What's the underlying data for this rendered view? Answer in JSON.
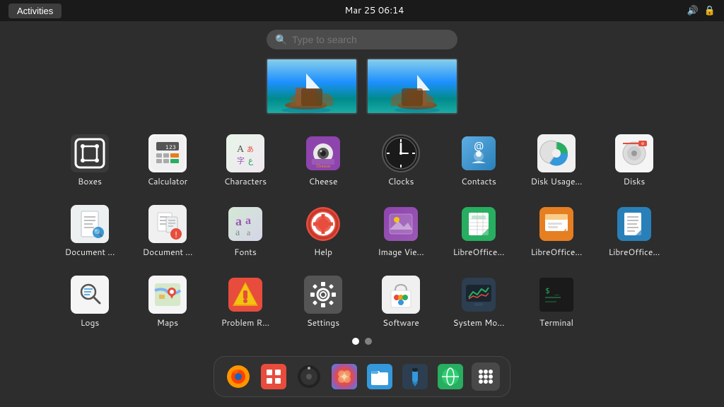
{
  "topbar": {
    "activities_label": "Activities",
    "datetime": "Mar 25  06:14"
  },
  "search": {
    "placeholder": "Type to search"
  },
  "apps": [
    {
      "id": "boxes",
      "label": "Boxes",
      "icon_type": "boxes"
    },
    {
      "id": "calculator",
      "label": "Calculator",
      "icon_type": "calculator"
    },
    {
      "id": "characters",
      "label": "Characters",
      "icon_type": "characters"
    },
    {
      "id": "cheese",
      "label": "Cheese",
      "icon_type": "cheese"
    },
    {
      "id": "clocks",
      "label": "Clocks",
      "icon_type": "clocks"
    },
    {
      "id": "contacts",
      "label": "Contacts",
      "icon_type": "contacts"
    },
    {
      "id": "diskusage",
      "label": "Disk Usage...",
      "icon_type": "diskusage"
    },
    {
      "id": "disks",
      "label": "Disks",
      "icon_type": "disks"
    },
    {
      "id": "docviewer",
      "label": "Document ...",
      "icon_type": "docviewer"
    },
    {
      "id": "docscanner",
      "label": "Document ...",
      "icon_type": "docscanner"
    },
    {
      "id": "fonts",
      "label": "Fonts",
      "icon_type": "fonts"
    },
    {
      "id": "help",
      "label": "Help",
      "icon_type": "help"
    },
    {
      "id": "imageviewer",
      "label": "Image Vie...",
      "icon_type": "imageviewer"
    },
    {
      "id": "libreoffice-calc",
      "label": "LibreOffice...",
      "icon_type": "libreoffice-calc"
    },
    {
      "id": "libreoffice-impress",
      "label": "LibreOffice...",
      "icon_type": "libreoffice-impress"
    },
    {
      "id": "libreoffice-writer",
      "label": "LibreOffice...",
      "icon_type": "libreoffice-writer"
    },
    {
      "id": "logs",
      "label": "Logs",
      "icon_type": "logs"
    },
    {
      "id": "maps",
      "label": "Maps",
      "icon_type": "maps"
    },
    {
      "id": "problemreport",
      "label": "Problem R...",
      "icon_type": "problemreport"
    },
    {
      "id": "settings",
      "label": "Settings",
      "icon_type": "settings"
    },
    {
      "id": "software",
      "label": "Software",
      "icon_type": "software"
    },
    {
      "id": "systemmonitor",
      "label": "System Mo...",
      "icon_type": "systemmonitor"
    },
    {
      "id": "terminal",
      "label": "Terminal",
      "icon_type": "terminal"
    }
  ],
  "dots": [
    {
      "active": true
    },
    {
      "active": false
    }
  ],
  "dock": {
    "items": [
      {
        "id": "firefox",
        "label": "Firefox"
      },
      {
        "id": "pinned1",
        "label": "App"
      },
      {
        "id": "rhythmbox",
        "label": "Rhythmbox"
      },
      {
        "id": "gnome-software-dock",
        "label": "Software"
      },
      {
        "id": "files",
        "label": "Files"
      },
      {
        "id": "stylus",
        "label": "Stylus"
      },
      {
        "id": "browser2",
        "label": "Browser"
      },
      {
        "id": "apps-grid",
        "label": "Show Apps"
      }
    ]
  }
}
